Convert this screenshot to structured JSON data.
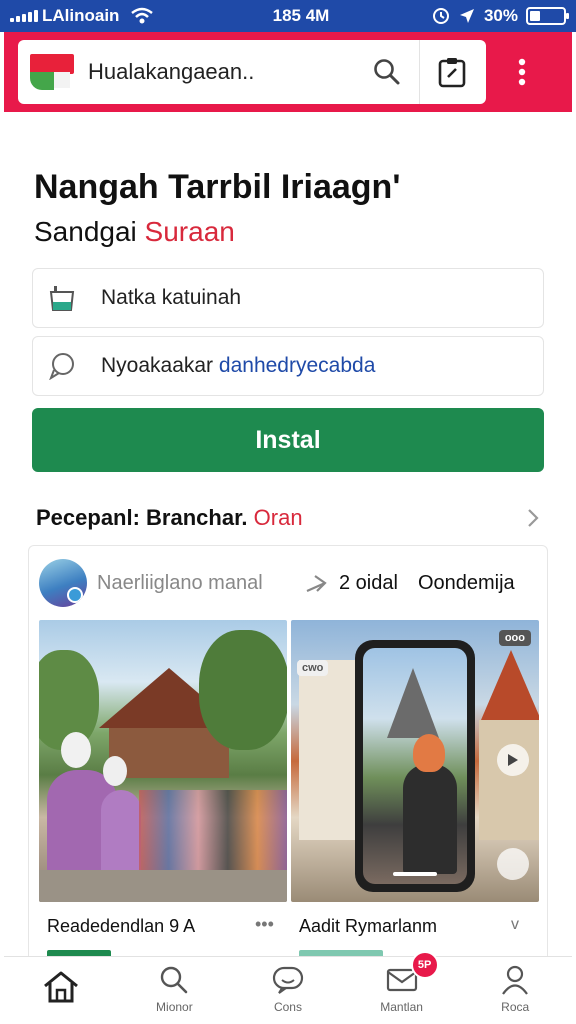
{
  "status_bar": {
    "carrier": "LAlinoain",
    "time": "185 4M",
    "battery": "30%",
    "battery_level": 0.3
  },
  "app_bar": {
    "url_text": "Hualakangaean..",
    "icons": [
      "flag-logo-icon",
      "search-icon",
      "clipboard-edit-icon",
      "more-vertical-icon"
    ]
  },
  "main": {
    "title": "Nangah Tarrbil Iriaagn'",
    "subtitle_prefix": "Sandgai",
    "subtitle_accent": "Suraan",
    "field1": {
      "icon": "cup-icon",
      "text": "Natka katuinah"
    },
    "field2": {
      "icon": "chat-bubble-icon",
      "text_prefix": "Nyoakaakar",
      "text_link": "danhedryecabda"
    },
    "install_label": "Instal",
    "section": {
      "title_prefix": "Pecepanl: Branchar.",
      "title_accent": "Oran",
      "icon": "chevron-right-icon"
    }
  },
  "card": {
    "author": "Naerliiglano manal",
    "stat1": "2 oidal",
    "stat2": "Oondemija",
    "photo_right_badge_left": "cwo",
    "photo_right_badge_right": "ooo",
    "caption_left": "Readedendlan 9 A",
    "caption_left_more": "•••",
    "caption_right": "Aadit Rymarlanm",
    "caption_right_more": "v"
  },
  "bottom_nav": {
    "items": [
      {
        "label": "",
        "icon": "home-icon"
      },
      {
        "label": "Mionor",
        "icon": "search-icon"
      },
      {
        "label": "Cons",
        "icon": "chat-face-icon"
      },
      {
        "label": "Mantlan",
        "icon": "mail-icon",
        "badge": "5P"
      },
      {
        "label": "Roca",
        "icon": "profile-icon"
      }
    ]
  },
  "colors": {
    "status_bar": "#1f4aa8",
    "app_bar": "#e8194a",
    "install": "#1e8a4f",
    "accent_red": "#d8293c",
    "link_blue": "#1f4aa8"
  }
}
